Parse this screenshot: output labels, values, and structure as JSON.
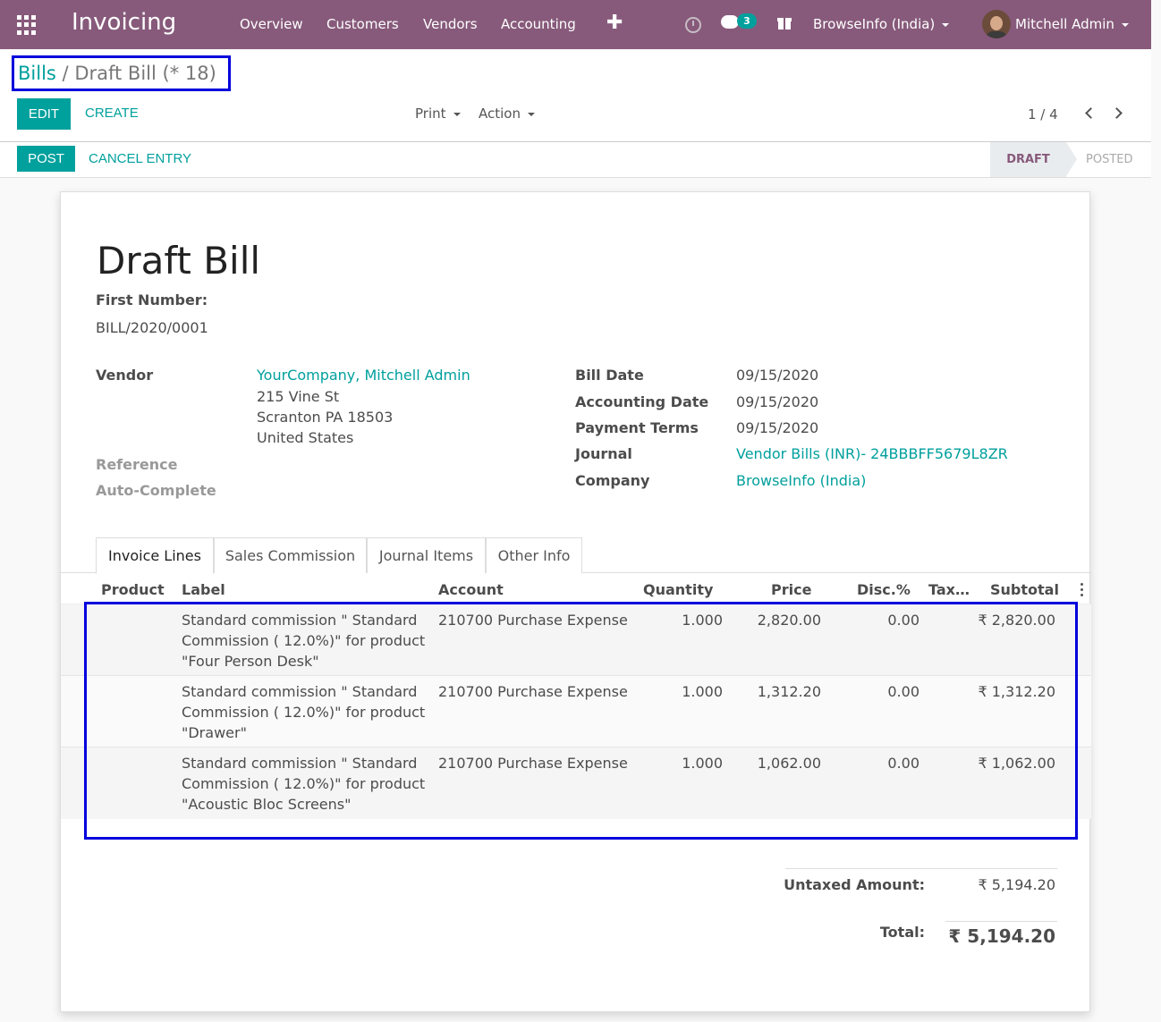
{
  "navbar": {
    "brand": "Invoicing",
    "menu": [
      "Overview",
      "Customers",
      "Vendors",
      "Accounting"
    ],
    "plus": "✚",
    "chat_count": "3",
    "company": "BrowseInfo (India)",
    "user": "Mitchell Admin"
  },
  "breadcrumb": {
    "parent": "Bills",
    "separator": "/",
    "current": "Draft Bill (* 18)"
  },
  "buttons": {
    "edit": "EDIT",
    "create": "CREATE",
    "print": "Print",
    "action": "Action",
    "post": "POST",
    "cancel_entry": "CANCEL ENTRY"
  },
  "pager": {
    "value": "1 / 4"
  },
  "status": {
    "draft": "DRAFT",
    "posted": "POSTED"
  },
  "sheet": {
    "title": "Draft Bill",
    "first_number_label": "First Number:",
    "first_number": "BILL/2020/0001",
    "vendor_label": "Vendor",
    "vendor_name": "YourCompany, Mitchell Admin",
    "vendor_street": "215 Vine St",
    "vendor_city": "Scranton PA 18503",
    "vendor_country": "United States",
    "reference_label": "Reference",
    "autocomplete_label": "Auto-Complete",
    "bill_date_label": "Bill Date",
    "bill_date": "09/15/2020",
    "accounting_date_label": "Accounting Date",
    "accounting_date": "09/15/2020",
    "payment_terms_label": "Payment Terms",
    "payment_terms": "09/15/2020",
    "journal_label": "Journal",
    "journal": "Vendor Bills (INR)- 24BBBFF5679L8ZR",
    "company_label": "Company",
    "company": "BrowseInfo (India)"
  },
  "tabs": [
    "Invoice Lines",
    "Sales Commission",
    "Journal Items",
    "Other Info"
  ],
  "table": {
    "headers": {
      "product": "Product",
      "label": "Label",
      "account": "Account",
      "quantity": "Quantity",
      "price": "Price",
      "disc": "Disc.%",
      "tax": "Tax…",
      "subtotal": "Subtotal"
    },
    "rows": [
      {
        "label_1": "Standard commission \" Standard",
        "label_2": "Commission ( 12.0%)\" for product",
        "label_3": "\"Four Person Desk\"",
        "account": "210700 Purchase Expense",
        "quantity": "1.000",
        "price": "2,820.00",
        "disc": "0.00",
        "subtotal": "₹ 2,820.00"
      },
      {
        "label_1": "Standard commission \" Standard",
        "label_2": "Commission ( 12.0%)\" for product",
        "label_3": "\"Drawer\"",
        "account": "210700 Purchase Expense",
        "quantity": "1.000",
        "price": "1,312.20",
        "disc": "0.00",
        "subtotal": "₹ 1,312.20"
      },
      {
        "label_1": "Standard commission \" Standard",
        "label_2": "Commission ( 12.0%)\" for product",
        "label_3": "\"Acoustic Bloc Screens\"",
        "account": "210700 Purchase Expense",
        "quantity": "1.000",
        "price": "1,062.00",
        "disc": "0.00",
        "subtotal": "₹ 1,062.00"
      }
    ]
  },
  "totals": {
    "untaxed_label": "Untaxed Amount:",
    "untaxed": "₹ 5,194.20",
    "total_label": "Total:",
    "total": "₹ 5,194.20"
  },
  "colors": {
    "navbar": "#875a7b",
    "accent": "#00a09d",
    "highlight": "#0000dd"
  }
}
